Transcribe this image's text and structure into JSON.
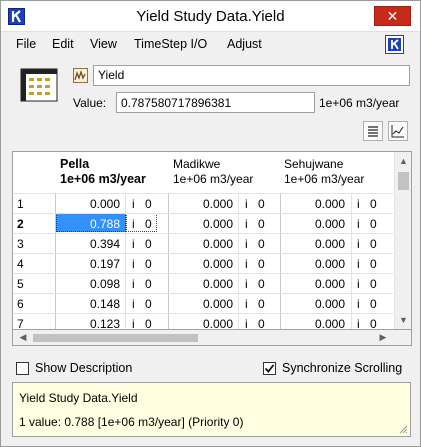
{
  "window": {
    "title": "Yield Study Data.Yield"
  },
  "menu": {
    "items": [
      "File",
      "Edit",
      "View",
      "TimeStep I/O",
      "Adjust"
    ]
  },
  "slot": {
    "name": "Yield",
    "value_label": "Value:",
    "value": "0.78758071789638​1",
    "units": "1e+06 m3/year"
  },
  "table": {
    "columns": [
      {
        "name": "Pella",
        "units": "1e+06 m3/year",
        "bold": true
      },
      {
        "name": "Madikwe",
        "units": "1e+06 m3/year",
        "bold": false
      },
      {
        "name": "Sehujwane",
        "units": "1e+06 m3/year",
        "bold": false
      }
    ],
    "rows": [
      {
        "num": "1",
        "cells": [
          [
            "0.000",
            "i",
            "0"
          ],
          [
            "0.000",
            "i",
            "0"
          ],
          [
            "0.000",
            "i",
            "0"
          ]
        ]
      },
      {
        "num": "2",
        "cells": [
          [
            "0.788",
            "i",
            "0"
          ],
          [
            "0.000",
            "i",
            "0"
          ],
          [
            "0.000",
            "i",
            "0"
          ]
        ]
      },
      {
        "num": "3",
        "cells": [
          [
            "0.394",
            "i",
            "0"
          ],
          [
            "0.000",
            "i",
            "0"
          ],
          [
            "0.000",
            "i",
            "0"
          ]
        ]
      },
      {
        "num": "4",
        "cells": [
          [
            "0.197",
            "i",
            "0"
          ],
          [
            "0.000",
            "i",
            "0"
          ],
          [
            "0.000",
            "i",
            "0"
          ]
        ]
      },
      {
        "num": "5",
        "cells": [
          [
            "0.098",
            "i",
            "0"
          ],
          [
            "0.000",
            "i",
            "0"
          ],
          [
            "0.000",
            "i",
            "0"
          ]
        ]
      },
      {
        "num": "6",
        "cells": [
          [
            "0.148",
            "i",
            "0"
          ],
          [
            "0.000",
            "i",
            "0"
          ],
          [
            "0.000",
            "i",
            "0"
          ]
        ]
      },
      {
        "num": "7",
        "cells": [
          [
            "0.123",
            "i",
            "0"
          ],
          [
            "0.000",
            "i",
            "0"
          ],
          [
            "0.000",
            "i",
            "0"
          ]
        ]
      }
    ],
    "selected_row": "2"
  },
  "options": {
    "show_description": "Show Description",
    "show_description_checked": false,
    "sync_scrolling": "Synchronize Scrolling",
    "sync_scrolling_checked": true
  },
  "description": {
    "line1": "Yield Study Data.Yield",
    "line2": "1 value:  0.788 [1e+06 m3/year]  (Priority 0)"
  },
  "colors": {
    "selection": "#3390ff",
    "close": "#c42b1c",
    "desc_bg": "#ffffe1",
    "brand": "#1d3fb8"
  },
  "icons": {
    "app": "riverware-logo-icon",
    "close": "close-icon",
    "help": "riverware-help-icon",
    "table": "table-series-icon",
    "slot": "yield-slot-icon",
    "list": "list-view-icon",
    "graph": "graph-view-icon"
  }
}
